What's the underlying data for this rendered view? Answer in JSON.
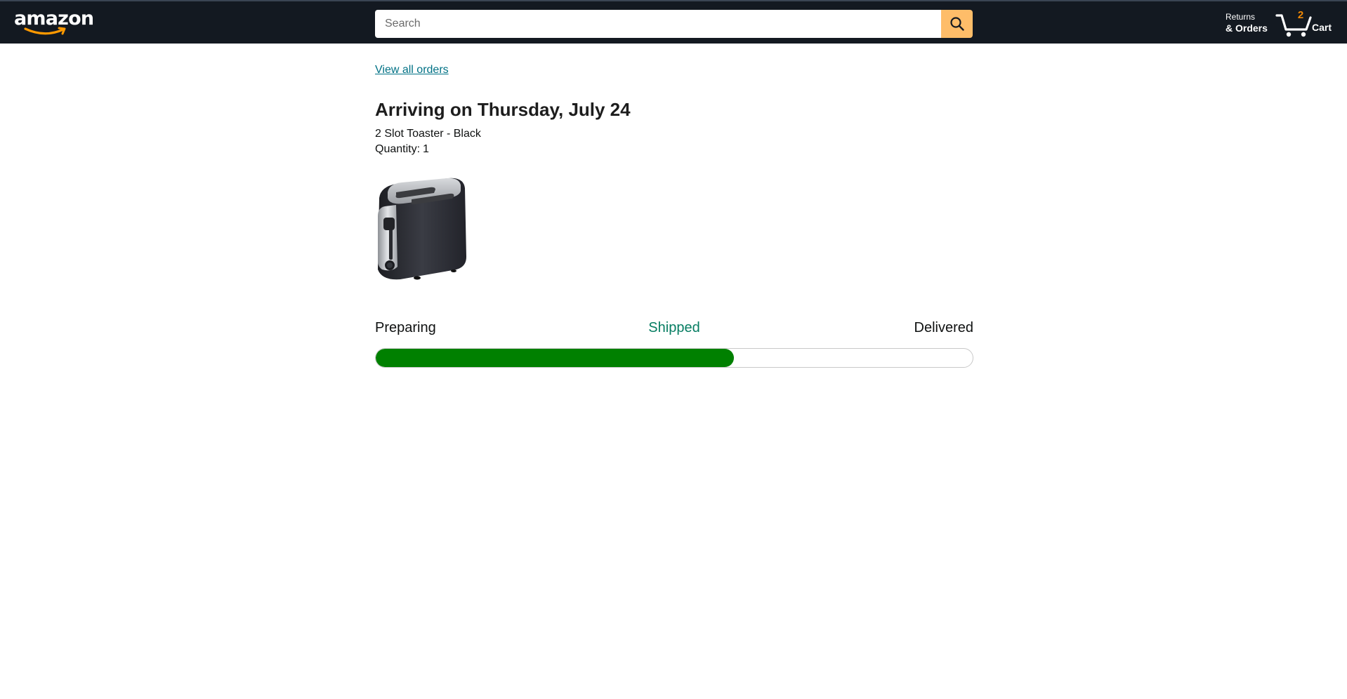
{
  "header": {
    "logo_text": "amazon",
    "search": {
      "placeholder": "Search",
      "value": ""
    },
    "returns": {
      "line1": "Returns",
      "line2": "& Orders"
    },
    "cart": {
      "count": "2",
      "label": "Cart"
    }
  },
  "order": {
    "view_all_link": "View all orders",
    "arrival_title": "Arriving on Thursday, July 24",
    "product_name": "2 Slot Toaster - Black",
    "quantity_label": "Quantity:",
    "quantity_value": "1",
    "product_image_icon": "toaster-image"
  },
  "tracking": {
    "steps": [
      "Preparing",
      "Shipped",
      "Delivered"
    ],
    "current_step": "Shipped",
    "progress_fraction": 0.6
  },
  "colors": {
    "header_bg": "#131921",
    "search_button": "#febd69",
    "link": "#007185",
    "shipped_text": "#067d62",
    "progress_fill": "#008000",
    "cart_count": "#f08804"
  }
}
